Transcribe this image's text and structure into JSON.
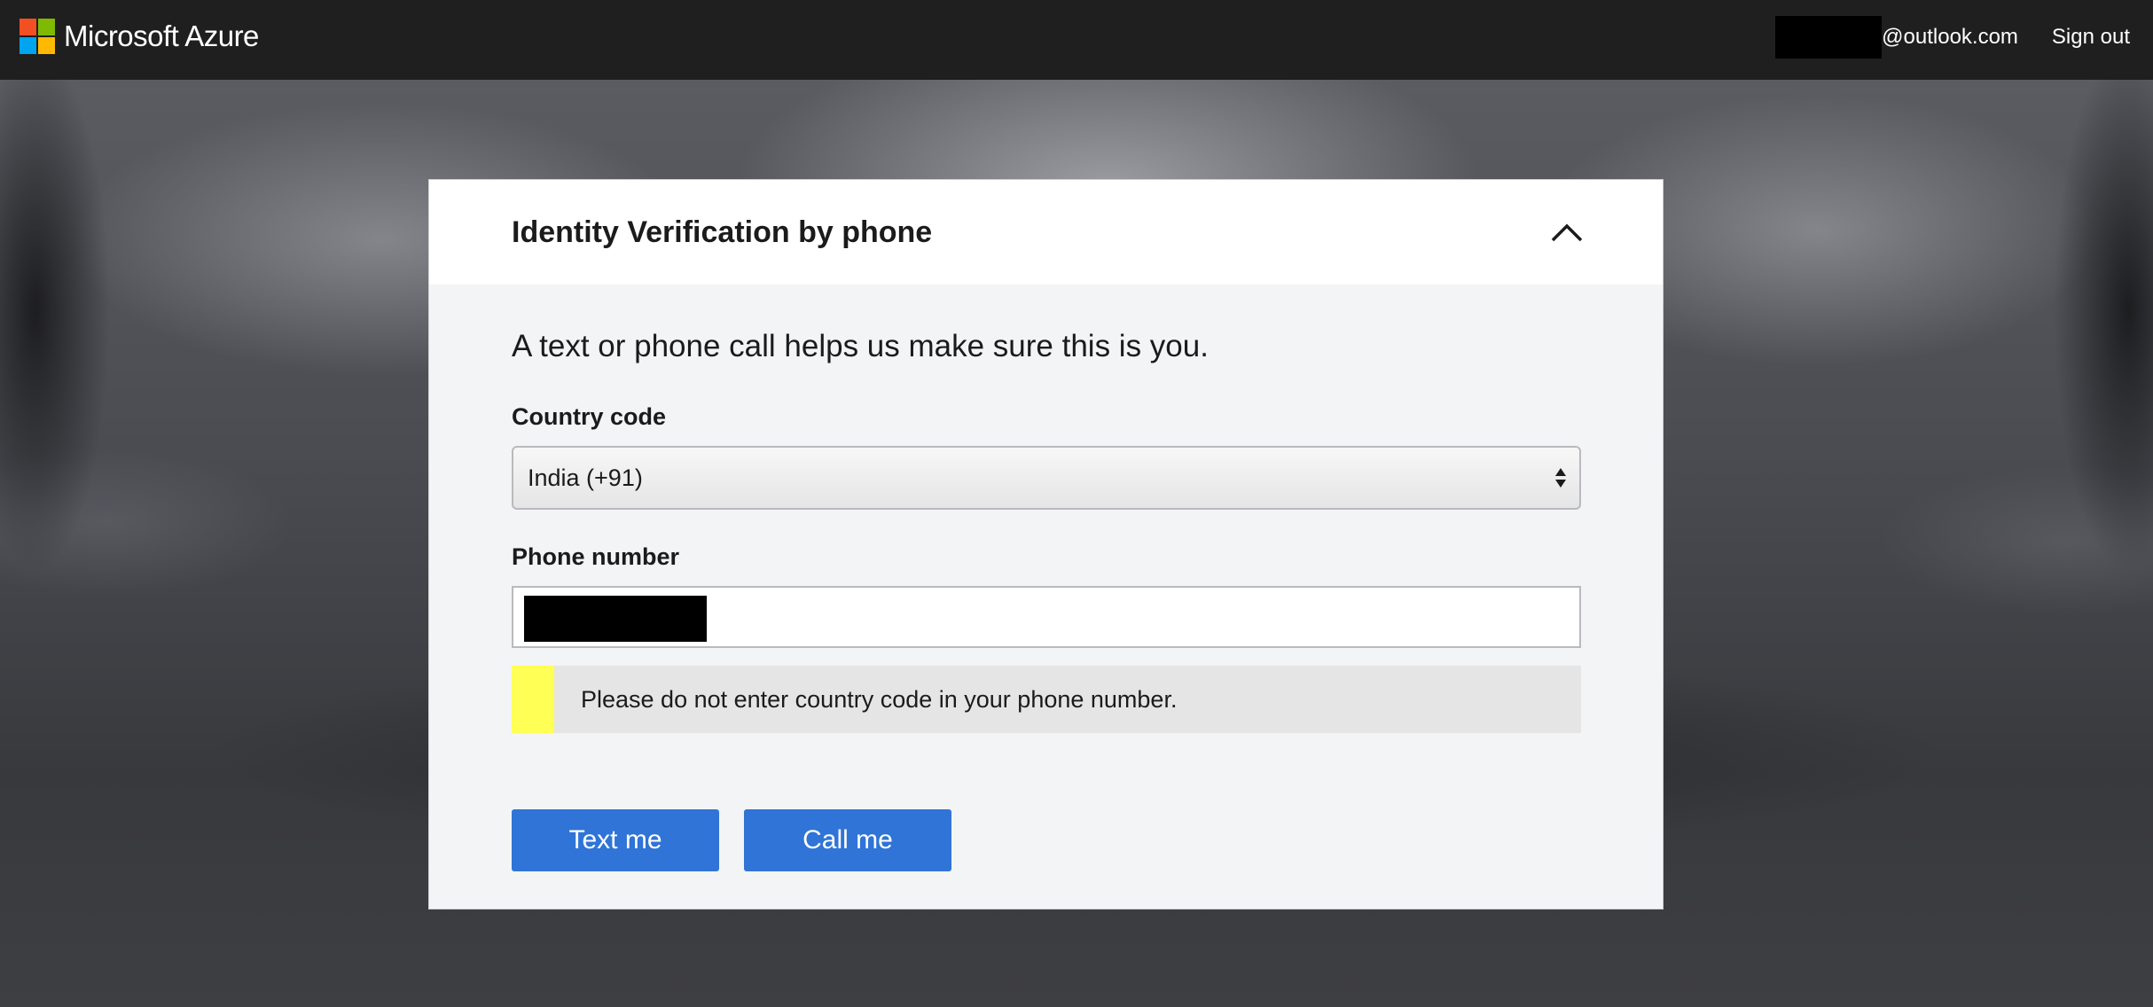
{
  "header": {
    "brand": "Microsoft Azure",
    "account_email_domain": "@outlook.com",
    "sign_out_label": "Sign out"
  },
  "dialog": {
    "title": "Identity Verification by phone",
    "intro": "A text or phone call helps us make sure this is you.",
    "country_code_label": "Country code",
    "country_code_value": "India (+91)",
    "phone_number_label": "Phone number",
    "notice_text": "Please do not enter country code in your phone number.",
    "text_me_label": "Text me",
    "call_me_label": "Call me"
  },
  "colors": {
    "topbar": "#1f1f1f",
    "primary_button": "#2f74d6",
    "notice_accent": "#ffff55",
    "logo_red": "#f25022",
    "logo_green": "#7fba00",
    "logo_blue": "#00a4ef",
    "logo_yellow": "#ffb900"
  },
  "icons": {
    "collapse": "chevron-up-icon",
    "select_arrows": "up-down-arrows-icon",
    "logo": "microsoft-logo-icon"
  }
}
